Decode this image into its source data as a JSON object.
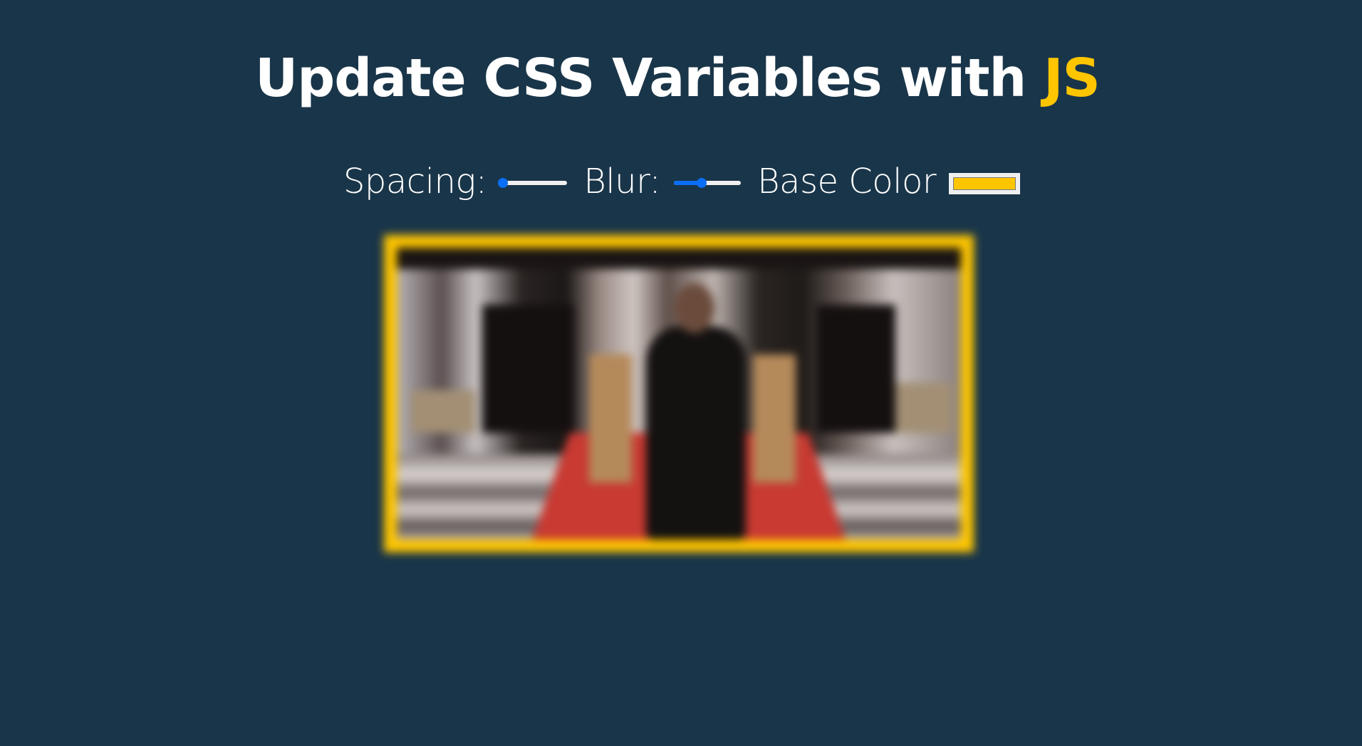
{
  "heading": {
    "text_main": "Update CSS Variables with ",
    "text_highlight": "JS"
  },
  "controls": {
    "spacing": {
      "label": "Spacing:",
      "min": 10,
      "max": 200,
      "value": 10,
      "unit": "px"
    },
    "blur": {
      "label": "Blur:",
      "min": 0,
      "max": 25,
      "value": 10,
      "unit": "px"
    },
    "base_color": {
      "label": "Base Color",
      "value": "#ffc600"
    }
  },
  "colors": {
    "background": "#193549",
    "accent": "#ffc600",
    "slider_accent": "#0a6ef6"
  }
}
